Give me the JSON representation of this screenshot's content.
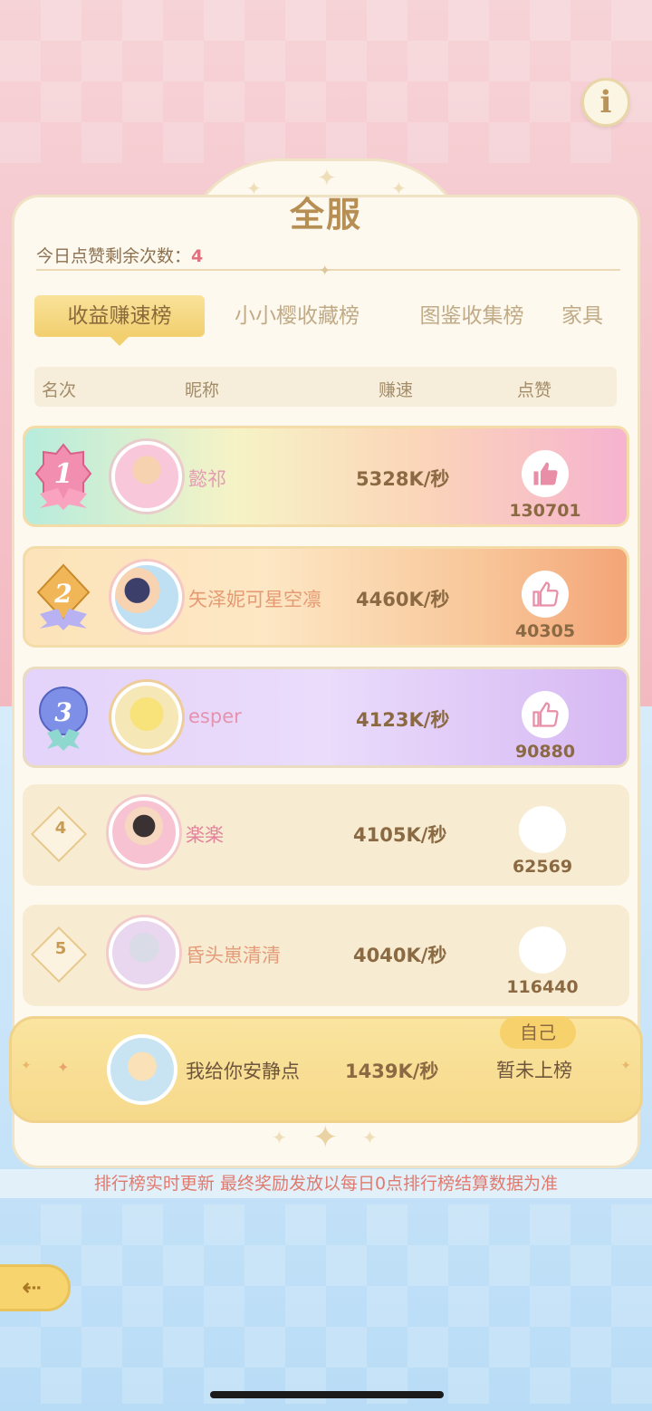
{
  "title": "全服",
  "likes_remaining": {
    "label": "今日点赞剩余次数：",
    "value": "4"
  },
  "tabs": [
    {
      "label": "收益赚速榜",
      "active": true
    },
    {
      "label": "小小樱收藏榜",
      "active": false
    },
    {
      "label": "图鉴收集榜",
      "active": false
    },
    {
      "label": "家具",
      "active": false
    }
  ],
  "columns": {
    "rank": "名次",
    "nickname": "昵称",
    "speed": "赚速",
    "like": "点赞"
  },
  "rows": [
    {
      "rank": "1",
      "nickname": "懿祁",
      "speed": "5328K/秒",
      "likes": "130701",
      "nick_color": "#e69bb4"
    },
    {
      "rank": "2",
      "nickname": "矢泽妮可星空凛",
      "speed": "4460K/秒",
      "likes": "40305",
      "nick_color": "#e59a73"
    },
    {
      "rank": "3",
      "nickname": "esper",
      "speed": "4123K/秒",
      "likes": "90880",
      "nick_color": "#e692ad"
    },
    {
      "rank": "4",
      "nickname": "楽楽",
      "speed": "4105K/秒",
      "likes": "62569",
      "nick_color": "#e2829b"
    },
    {
      "rank": "5",
      "nickname": "昏头崽清清",
      "speed": "4040K/秒",
      "likes": "116440",
      "nick_color": "#e59b7a"
    }
  ],
  "self": {
    "badge": "自己",
    "nickname": "我给你安静点",
    "speed": "1439K/秒",
    "rank_text": "暂未上榜"
  },
  "footer_note": "排行榜实时更新 最终奖励发放以每日0点排行榜结算数据为准",
  "icons": {
    "info": "info-icon",
    "like": "thumbs-up-icon",
    "back": "back-arrow-icon"
  },
  "colors": {
    "accent_gold": "#f2cf6f",
    "rank_text": "#8b6a43",
    "highlight": "#e0717f"
  }
}
